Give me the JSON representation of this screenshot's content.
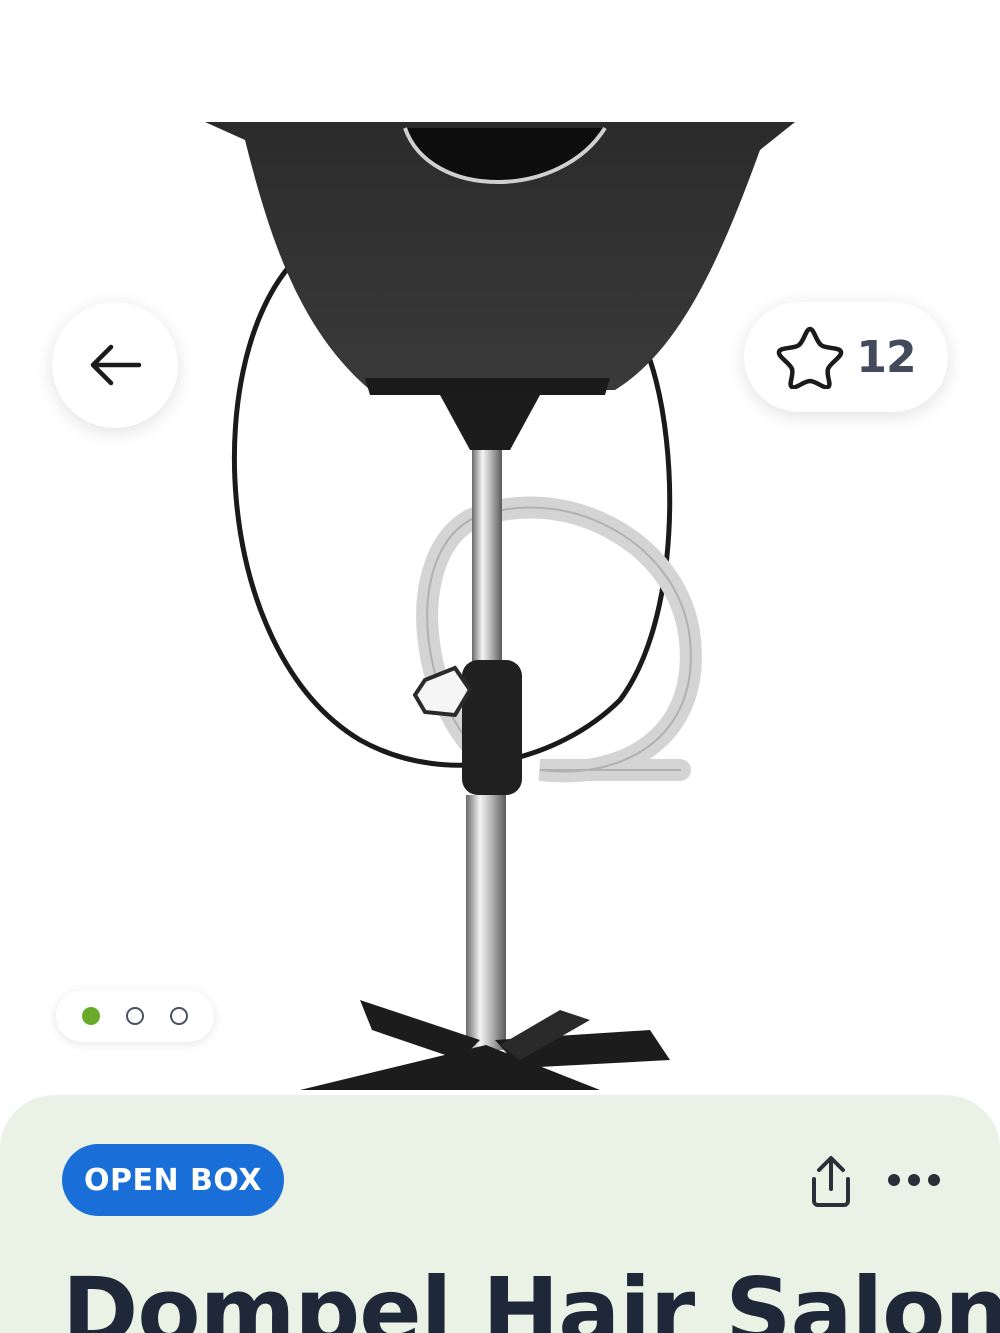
{
  "product": {
    "image_alt": "Portable hair salon shampoo basin on a stand",
    "favorite_count": "12",
    "image_count": 3,
    "active_image_index": 0,
    "badge": "OPEN BOX",
    "title": "Dompel Hair Salon"
  },
  "icons": {
    "back": "arrow-left-icon",
    "favorite": "star-outline-icon",
    "share": "share-icon",
    "more": "more-horizontal-icon"
  },
  "colors": {
    "badge": "#1a6ed8",
    "active_dot": "#6aaa2a",
    "info_panel": "#e9f2e5",
    "title": "#1f2838"
  }
}
